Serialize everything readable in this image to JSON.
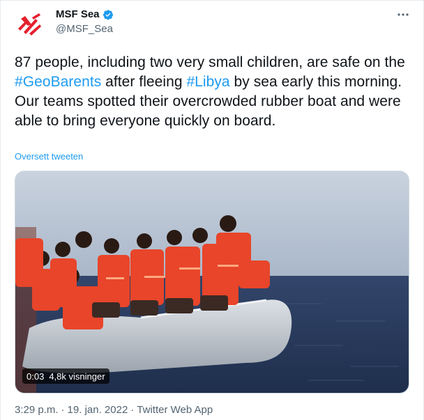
{
  "account": {
    "display_name": "MSF Sea",
    "handle": "@MSF_Sea",
    "verified": true,
    "brand_color": "#e4212e",
    "avatar_icon": "msf-logo-icon"
  },
  "tweet": {
    "part1": "87 people, including two very small children, are safe on the ",
    "hashtag1": "#GeoBarents",
    "part2": " after fleeing ",
    "hashtag2": "#Libya",
    "part3": " by sea early this morning. Our teams spotted their overcrowded rubber boat and were able to bring everyone quickly on board.",
    "translate_label": "Oversett tweeten",
    "hashtag_color": "#1d9bf0"
  },
  "video": {
    "duration": "0:03",
    "views": "4,8k visninger"
  },
  "meta": {
    "time": "3:29 p.m.",
    "separator1": "·",
    "date": "19. jan. 2022",
    "separator2": "·",
    "source": "Twitter Web App"
  }
}
